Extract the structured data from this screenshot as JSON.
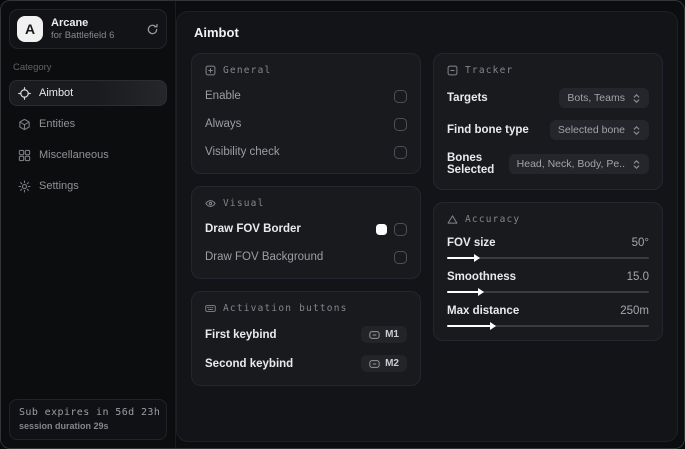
{
  "app": {
    "name": "Arcane",
    "subtitle": "for Battlefield 6",
    "logo_letter": "A"
  },
  "sidebar": {
    "category_label": "Category",
    "items": [
      {
        "label": "Aimbot",
        "icon": "crosshair-icon",
        "active": true
      },
      {
        "label": "Entities",
        "icon": "cube-icon",
        "active": false
      },
      {
        "label": "Miscellaneous",
        "icon": "grid-icon",
        "active": false
      },
      {
        "label": "Settings",
        "icon": "gear-icon",
        "active": false
      }
    ],
    "status": {
      "sub": "Sub expires in 56d 23h",
      "session": "session duration 29s"
    }
  },
  "main": {
    "title": "Aimbot",
    "general": {
      "header": "General",
      "rows": [
        {
          "label": "Enable",
          "checked": false
        },
        {
          "label": "Always",
          "checked": false
        },
        {
          "label": "Visibility check",
          "checked": false
        }
      ]
    },
    "visual": {
      "header": "Visual",
      "rows": [
        {
          "label": "Draw FOV Border",
          "swatch": "#ffffff",
          "swatch_style": "background:#ffffff",
          "checked": false
        },
        {
          "label": "Draw FOV Background",
          "checked": false
        }
      ]
    },
    "activation": {
      "header": "Activation buttons",
      "rows": [
        {
          "label": "First keybind",
          "key": "M1"
        },
        {
          "label": "Second keybind",
          "key": "M2"
        }
      ]
    },
    "tracker": {
      "header": "Tracker",
      "rows": [
        {
          "label": "Targets",
          "value": "Bots, Teams"
        },
        {
          "label": "Find bone type",
          "value": "Selected bone"
        },
        {
          "label": "Bones Selected",
          "value": "Head, Neck, Body, Pe.."
        }
      ]
    },
    "accuracy": {
      "header": "Accuracy",
      "sliders": [
        {
          "label": "FOV size",
          "value": "50°",
          "percent": 14,
          "fill_style": "width:14%"
        },
        {
          "label": "Smoothness",
          "value": "15.0",
          "percent": 16,
          "fill_style": "width:16%"
        },
        {
          "label": "Max distance",
          "value": "250m",
          "percent": 22,
          "fill_style": "width:22%"
        }
      ]
    }
  },
  "colors": {
    "accent_swatch": "#ffffff",
    "panel_bg": "#131418",
    "card_bg": "#191a1e"
  }
}
